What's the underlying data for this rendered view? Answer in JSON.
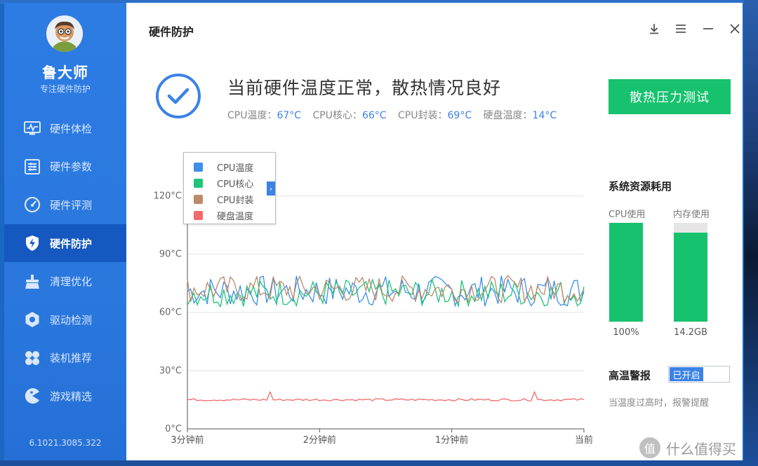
{
  "app": {
    "name": "鲁大师",
    "subtitle": "专注硬件防护",
    "version": "6.1021.3085.322"
  },
  "sidebar": {
    "items": [
      {
        "label": "硬件体检",
        "icon": "monitor-pulse-icon",
        "active": false
      },
      {
        "label": "硬件参数",
        "icon": "parameters-list-icon",
        "active": false
      },
      {
        "label": "硬件评测",
        "icon": "speedometer-icon",
        "active": false
      },
      {
        "label": "硬件防护",
        "icon": "shield-bolt-icon",
        "active": true
      },
      {
        "label": "清理优化",
        "icon": "broom-icon",
        "active": false
      },
      {
        "label": "驱动检测",
        "icon": "gear-driver-icon",
        "active": false
      },
      {
        "label": "装机推荐",
        "icon": "four-leaf-icon",
        "active": false
      },
      {
        "label": "游戏精选",
        "icon": "game-pacman-icon",
        "active": false
      }
    ]
  },
  "header": {
    "title": "硬件防护"
  },
  "status": {
    "message": "当前硬件温度正常，散热情况良好",
    "readings": [
      {
        "label": "CPU温度：",
        "value": "67°C"
      },
      {
        "label": "CPU核心：",
        "value": "66°C"
      },
      {
        "label": "CPU封装：",
        "value": "69°C"
      },
      {
        "label": "硬盘温度：",
        "value": "14°C"
      }
    ]
  },
  "actions": {
    "stress_test_label": "散热压力测试"
  },
  "chart_data": {
    "type": "line",
    "y_tick_labels": [
      "0°C",
      "30°C",
      "60°C",
      "90°C",
      "120°C"
    ],
    "ylim": [
      0,
      140
    ],
    "x_tick_labels": [
      "3分钟前",
      "2分钟前",
      "1分钟前",
      "当前"
    ],
    "grid": true,
    "legend_position": "top-left",
    "series": [
      {
        "name": "CPU温度",
        "color": "#3b8fe8",
        "base": 71,
        "amp": 8
      },
      {
        "name": "CPU核心",
        "color": "#1ec47a",
        "base": 70,
        "amp": 7
      },
      {
        "name": "CPU封装",
        "color": "#bd8a6a",
        "base": 72,
        "amp": 7
      },
      {
        "name": "硬盘温度",
        "color": "#f26a6a",
        "base": 15,
        "amp": 0.6
      }
    ]
  },
  "resources": {
    "title": "系统资源耗用",
    "cpu": {
      "label": "CPU使用",
      "value_text": "100%",
      "fraction": 1.0
    },
    "memory": {
      "label": "内存使用",
      "value_text": "14.2GB",
      "fraction": 0.9
    }
  },
  "alarm": {
    "title": "高温警报",
    "toggle_label": "已开启",
    "enabled": true,
    "description": "当温度过高时，报警提醒"
  },
  "watermark": {
    "text": "什么值得买",
    "mark": "值"
  },
  "colors": {
    "accent": "#3b82e6",
    "sidebar": "#2a78de",
    "sidebar_active": "#1558c0",
    "green": "#16c26d"
  }
}
